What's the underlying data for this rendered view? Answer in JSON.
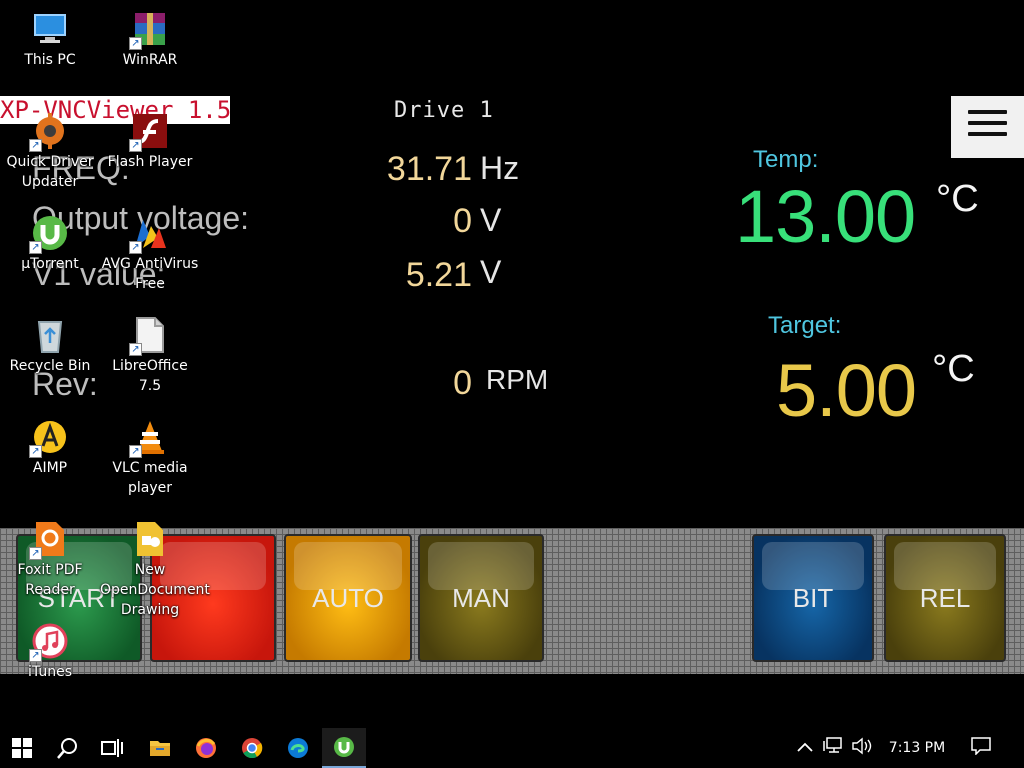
{
  "vnc": {
    "title": "XP-VNCViewer 1.50"
  },
  "hmi": {
    "drive_title": "Drive 1",
    "rows": [
      {
        "label": "FREQ:",
        "value": "31.71",
        "unit": "Hz"
      },
      {
        "label": "Output voltage:",
        "value": "0",
        "unit": "V"
      },
      {
        "label": "V1 value:",
        "value": "5.21",
        "unit": "V"
      },
      {
        "label": "Rev:",
        "value": "0",
        "unit": "RPM"
      }
    ],
    "temp": {
      "label": "Temp:",
      "value": "13.00",
      "unit": "°C"
    },
    "target": {
      "label": "Target:",
      "value": "5.00",
      "unit": "°C"
    },
    "buttons": [
      {
        "label": "START",
        "color": "#1f7a3a"
      },
      {
        "label": "",
        "color": "#e8261a"
      },
      {
        "label": "AUTO",
        "color": "#f0a20c"
      },
      {
        "label": "MAN",
        "color": "#7a6a18"
      },
      {
        "label": "BIT",
        "color": "#0d4f86"
      },
      {
        "label": "REL",
        "color": "#7a6a18"
      }
    ],
    "colors": {
      "temp": "#38e07a",
      "target": "#e8c84a",
      "label_cyan": "#4fc6e0"
    }
  },
  "desktop": {
    "icons": [
      {
        "label": "This PC",
        "icon": "computer-icon"
      },
      {
        "label": "WinRAR",
        "icon": "winrar-icon"
      },
      {
        "label": "Quick Driver Updater",
        "icon": "gear-icon"
      },
      {
        "label": "Flash Player",
        "icon": "flash-icon"
      },
      {
        "label": "µTorrent",
        "icon": "utorrent-icon"
      },
      {
        "label": "AVG AntiVirus Free",
        "icon": "avg-icon"
      },
      {
        "label": "Recycle Bin",
        "icon": "recycle-bin-icon"
      },
      {
        "label": "LibreOffice 7.5",
        "icon": "libreoffice-icon"
      },
      {
        "label": "AIMP",
        "icon": "aimp-icon"
      },
      {
        "label": "VLC media player",
        "icon": "vlc-icon"
      },
      {
        "label": "Foxit PDF Reader",
        "icon": "foxit-icon"
      },
      {
        "label": "New OpenDocument Drawing",
        "icon": "draw-document-icon"
      },
      {
        "label": "iTunes",
        "icon": "itunes-icon"
      }
    ]
  },
  "taskbar": {
    "time": "7:13 PM",
    "items": [
      "start-icon",
      "search-icon",
      "task-view-icon",
      "file-explorer-icon",
      "firefox-icon",
      "chrome-icon",
      "edge-icon",
      "utorrent-icon"
    ]
  }
}
